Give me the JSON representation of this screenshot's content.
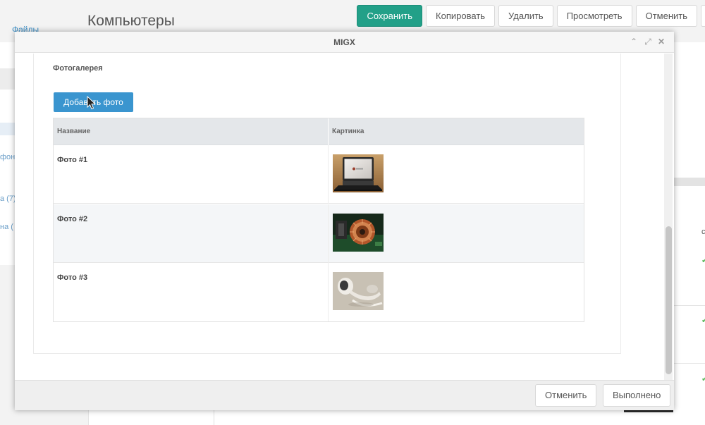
{
  "background": {
    "sidebar": {
      "files_link": "Файлы",
      "tree_items": [
        "фон",
        "а (7)",
        "на ("
      ]
    },
    "page_title": "Компьютеры",
    "toolbar": {
      "save": "Сохранить",
      "copy": "Копировать",
      "delete": "Удалить",
      "view": "Просмотреть",
      "cancel": "Отменить"
    },
    "right_grid_col": "с"
  },
  "modal": {
    "title": "MIGX",
    "field_label": "Фотогалерея",
    "add_button": "Добавить фото",
    "grid": {
      "columns": [
        "Название",
        "Картинка"
      ],
      "rows": [
        {
          "name": "Фото #1",
          "image": "laptop-photo"
        },
        {
          "name": "Фото #2",
          "image": "inductor-coil-photo"
        },
        {
          "name": "Фото #3",
          "image": "earbuds-photo"
        }
      ]
    },
    "footer": {
      "cancel": "Отменить",
      "done": "Выполнено"
    }
  },
  "colors": {
    "primary_green": "#22a088",
    "primary_blue": "#3a95cf",
    "link_blue": "#3b8fc7"
  }
}
